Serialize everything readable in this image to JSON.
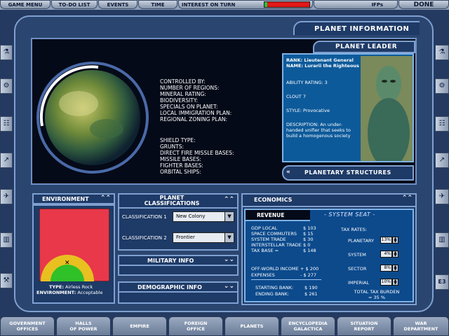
{
  "top_menu": {
    "game_menu": "GAME MENU",
    "todo_list": "TO-DO LIST",
    "events": "EVENTS",
    "time": "TIME",
    "interest_label": "INTEREST ON TURN",
    "ifps": "IFPs",
    "done": "DONE"
  },
  "panel_title": "PLANET INFORMATION",
  "planet_info_labels": {
    "controlled_by": "CONTROLLED BY:",
    "regions": "NUMBER OF REGIONS:",
    "mineral": "MINERAL RATING:",
    "biodiversity": "BIODIVERSITY:",
    "specials": "SPECIALS ON PLANET:",
    "immigration": "LOCAL IMMIGRATION PLAN:",
    "zoning": "REGIONAL ZONING PLAN:",
    "shield": "SHIELD TYPE:",
    "grunts": "GRUNTS:",
    "direct_fire": "DIRECT FIRE MISSLE BASES:",
    "missile": "MISSILE BASES:",
    "fighter": "FIGHTER BASES:",
    "orbital": "ORBITAL SHIPS:"
  },
  "leader": {
    "title": "PLANET LEADER",
    "rank": "RANK: Lieutenant General",
    "name": "NAME: Lurarii the Righteous",
    "ability": "ABILITY RATING: 3",
    "clout": "CLOUT 7",
    "style": "STYLE: Provocative",
    "description": "DESCRIPTION: An under-handed unifier that seeks to build a homogenous society"
  },
  "planetary_structures": "PLANETARY STRUCTURES",
  "environment": {
    "title": "ENVIRONMENT",
    "type_label": "TYPE:",
    "type_value": "Airless Rock",
    "env_label": "ENVIRONMENT:",
    "env_value": "Acceptable"
  },
  "classifications": {
    "title_line1": "PLANET",
    "title_line2": "CLASSIFICATIONS",
    "c1_label": "CLASSIFICATION 1",
    "c1_value": "New Colony",
    "c2_label": "CLASSIFICATION 2",
    "c2_value": "Frontier"
  },
  "military_info": "MILITARY INFO",
  "demographic_info": "DEMOGRAPHIC INFO",
  "economics": {
    "title": "ECONOMICS",
    "revenue": "REVENUE",
    "system_seat": "- SYSTEM SEAT -",
    "gdp_label": "GDP LOCAL",
    "gdp_value": "$ 103",
    "commuters_label": "SPACE COMMUTERS",
    "commuters_value": "$ 15",
    "system_trade_label": "SYSTEM TRADE",
    "system_trade_value": "$ 30",
    "interstellar_label": "INTERSTELLAR TRADE",
    "interstellar_value": "$ 0",
    "taxbase_label": "TAX BASE =",
    "taxbase_value": "$ 148",
    "offworld_label": "OFF-WORLD INCOME",
    "offworld_value": "+ $ 200",
    "expenses_label": "EXPENSES",
    "expenses_value": "- $ 277",
    "starting_label": "STARTING BANK:",
    "starting_value": "$ 190",
    "ending_label": "ENDING BANK:",
    "ending_value": "$ 261",
    "tax_rates": "TAX RATES:",
    "planetary_label": "PLANETARY",
    "planetary_value": "13%",
    "system_label": "SYSTEM",
    "system_value": "4%",
    "sector_label": "SECTOR",
    "sector_value": "8%",
    "imperial_label": "IMPERIAL",
    "imperial_value": "10%",
    "total_line1": "TOTAL TAX BURDEN",
    "total_line2": "= 35 %"
  },
  "side_e3": "E3",
  "bottom_tabs": [
    {
      "l1": "GOVERNMENT",
      "l2": "OFFICES"
    },
    {
      "l1": "HALLS",
      "l2": "OF POWER"
    },
    {
      "l1": "EMPIRE",
      "l2": ""
    },
    {
      "l1": "FOREIGN",
      "l2": "OFFICE"
    },
    {
      "l1": "PLANETS",
      "l2": ""
    },
    {
      "l1": "ENCYCLOPEDIA",
      "l2": "GALACTICA"
    },
    {
      "l1": "SITUATION",
      "l2": "REPORT"
    },
    {
      "l1": "WAR",
      "l2": "DEPARTMENT"
    }
  ],
  "colors": {
    "interest_bar": "#e01818",
    "interest_fill": "#28c040",
    "env_bg": "#e8384a",
    "zone_yellow": "#e8c020",
    "zone_green": "#30c028"
  }
}
